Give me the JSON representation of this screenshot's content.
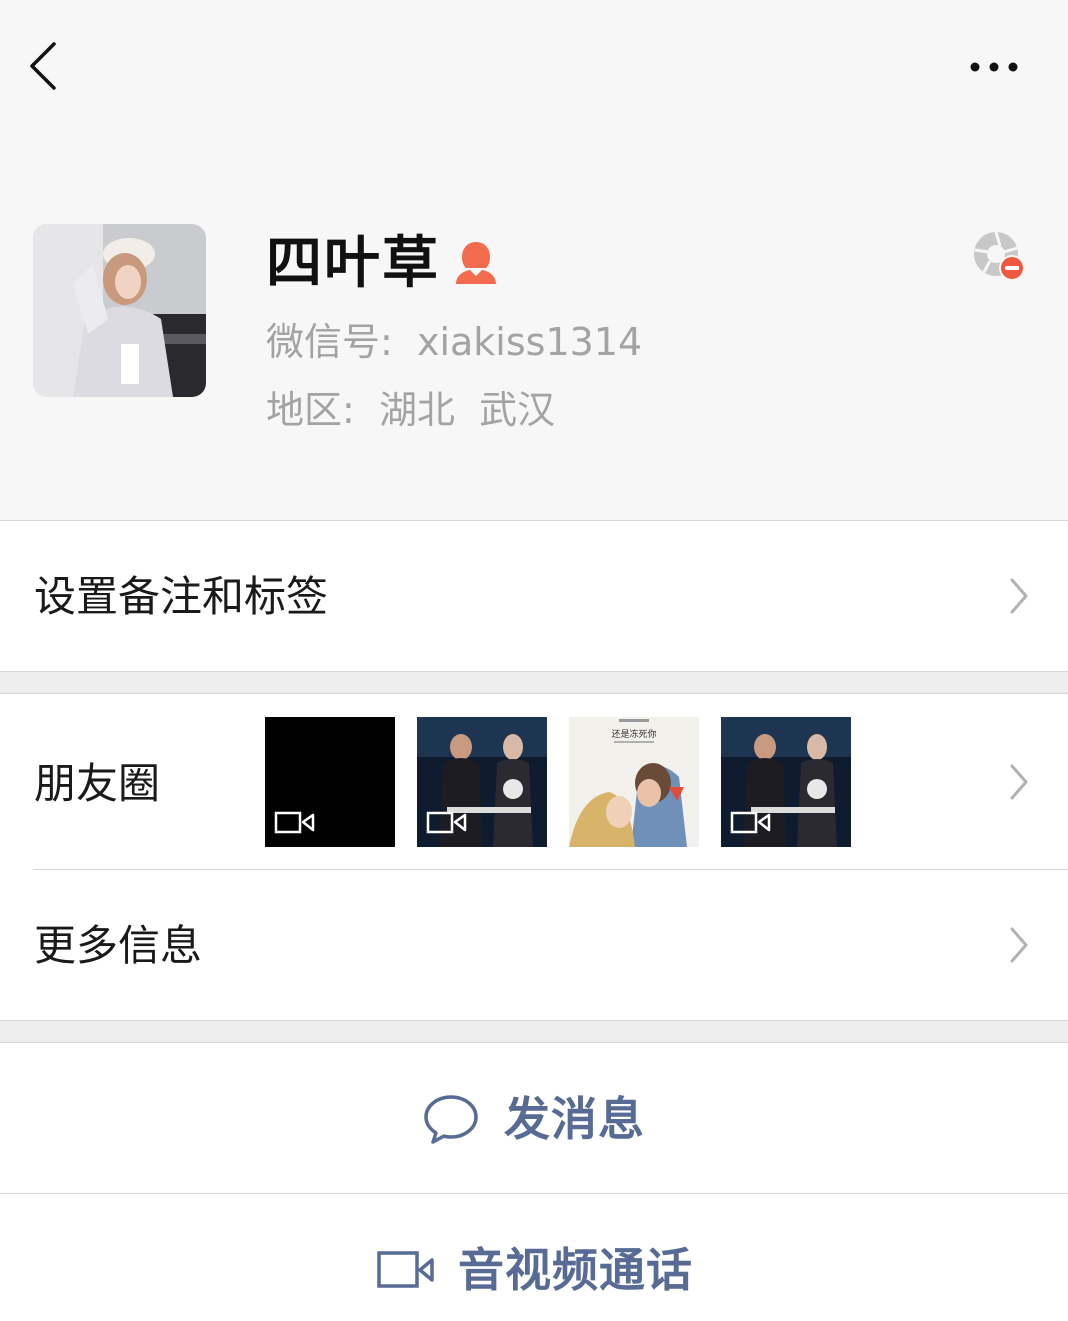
{
  "nav": {
    "back_icon": "chevron-left-icon",
    "more_icon": "more-dots-icon"
  },
  "profile": {
    "name": "四叶草",
    "gender_icon": "female-user-icon",
    "wechat_id": "微信号:  xiakiss1314",
    "region": "地区:  湖北  武汉",
    "star_icon": "aperture-minus-icon"
  },
  "menu": {
    "remarks_label": "设置备注和标签",
    "moments_label": "朋友圈",
    "more_info_label": "更多信息"
  },
  "moments_thumbs": [
    {
      "kind": "video",
      "desc": "black-video-thumb"
    },
    {
      "kind": "video",
      "desc": "concert-video-thumb"
    },
    {
      "kind": "image",
      "desc": "illustration-thumb",
      "caption": "还是冻死你"
    },
    {
      "kind": "video",
      "desc": "concert-video-thumb"
    }
  ],
  "actions": {
    "message_label": "发消息",
    "call_label": "音视频通话"
  },
  "colors": {
    "link_blue": "#576b95",
    "gender_red": "#f26b4f",
    "background": "#ededed",
    "header_bg": "#f7f7f7"
  }
}
